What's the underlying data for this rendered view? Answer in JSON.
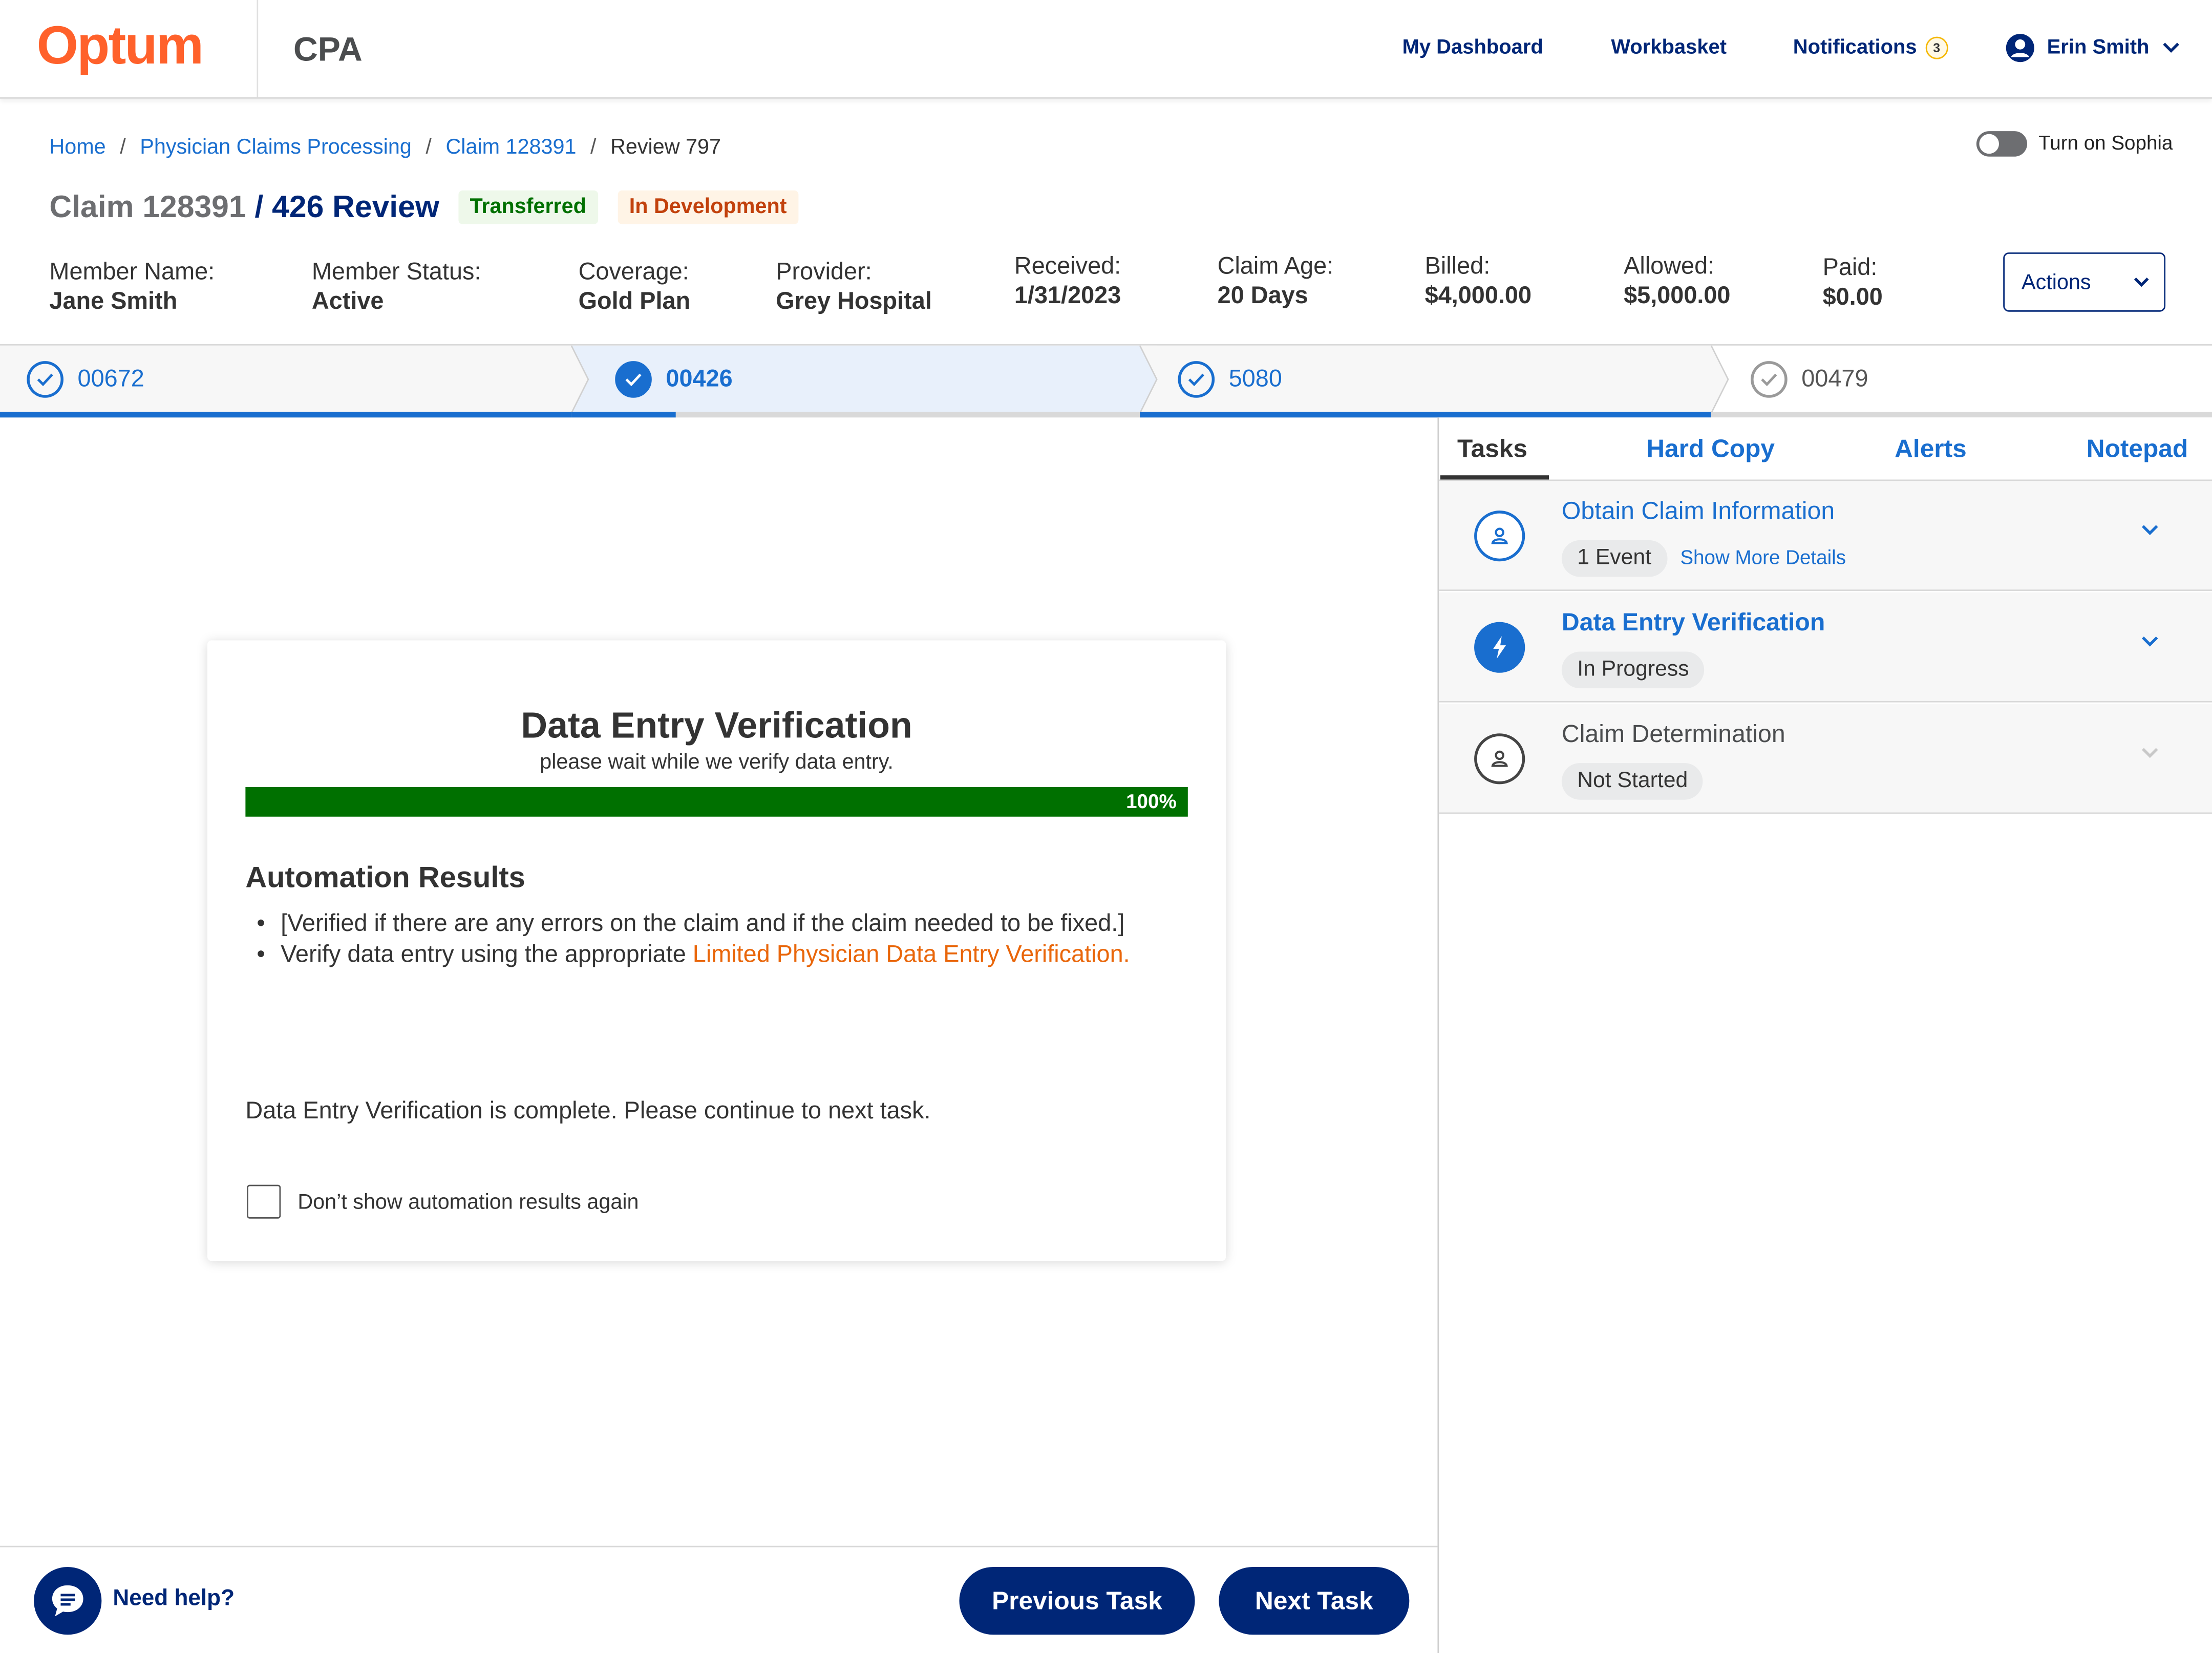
{
  "header": {
    "logo": "Optum",
    "app_name": "CPA",
    "nav": {
      "dashboard": "My Dashboard",
      "workbasket": "Workbasket",
      "notifications": "Notifications",
      "notifications_count": "3"
    },
    "user_name": "Erin Smith"
  },
  "breadcrumb": {
    "items": [
      "Home",
      "Physician Claims Processing",
      "Claim 128391"
    ],
    "current": "Review 797",
    "separator": "/"
  },
  "sophia_toggle": {
    "label": "Turn on Sophia",
    "on": false
  },
  "claim": {
    "number": "Claim 128391",
    "review": "/ 426 Review",
    "badges": [
      "Transferred",
      "In Development"
    ],
    "fields": [
      {
        "label": "Member Name:",
        "value": "Jane Smith"
      },
      {
        "label": "Member Status:",
        "value": "Active"
      },
      {
        "label": "Coverage:",
        "value": "Gold Plan"
      },
      {
        "label": "Provider:",
        "value": "Grey Hospital"
      },
      {
        "label": "Received:",
        "value": "1/31/2023"
      },
      {
        "label": "Claim Age:",
        "value": "20 Days"
      },
      {
        "label": "Billed:",
        "value": "$4,000.00"
      },
      {
        "label": "Allowed:",
        "value": "$5,000.00"
      },
      {
        "label": "Paid:",
        "value": "$0.00"
      }
    ],
    "actions_label": "Actions"
  },
  "stepper": {
    "steps": [
      {
        "id": "00672",
        "state": "complete"
      },
      {
        "id": "00426",
        "state": "current"
      },
      {
        "id": "5080",
        "state": "complete"
      },
      {
        "id": "00479",
        "state": "pending"
      }
    ]
  },
  "verification": {
    "title": "Data Entry Verification",
    "subtitle": "please wait while we verify data entry.",
    "progress": 1.0,
    "progress_label": "100%",
    "results_title": "Automation Results",
    "bullet1": "[Verified if there are any errors on the claim and if the claim needed to be fixed.]",
    "bullet2_text": "Verify data entry using the appropriate ",
    "bullet2_link": "Limited Physician Data Entry Verification.",
    "complete_message": "Data Entry Verification is complete. Please continue to next task.",
    "checkbox_label": "Don’t show automation results again",
    "checkbox_checked": false
  },
  "right_panel": {
    "tabs": [
      "Tasks",
      "Hard Copy",
      "Alerts",
      "Notepad"
    ],
    "active_tab": "Tasks",
    "tasks": [
      {
        "title": "Obtain Claim Information",
        "chip": "1 Event",
        "more": "Show More Details",
        "status": "complete"
      },
      {
        "title": "Data Entry Verification",
        "chip": "In Progress",
        "status": "active"
      },
      {
        "title": "Claim Determination",
        "chip": "Not Started",
        "status": "not-started"
      }
    ]
  },
  "footer": {
    "help": "Need help?",
    "previous": "Previous Task",
    "next": "Next Task"
  },
  "colors": {
    "brand_orange": "#ff612b",
    "navy": "#002677",
    "link_blue": "#196ecf",
    "success_green": "#007000",
    "link_orange": "#e9660a"
  }
}
